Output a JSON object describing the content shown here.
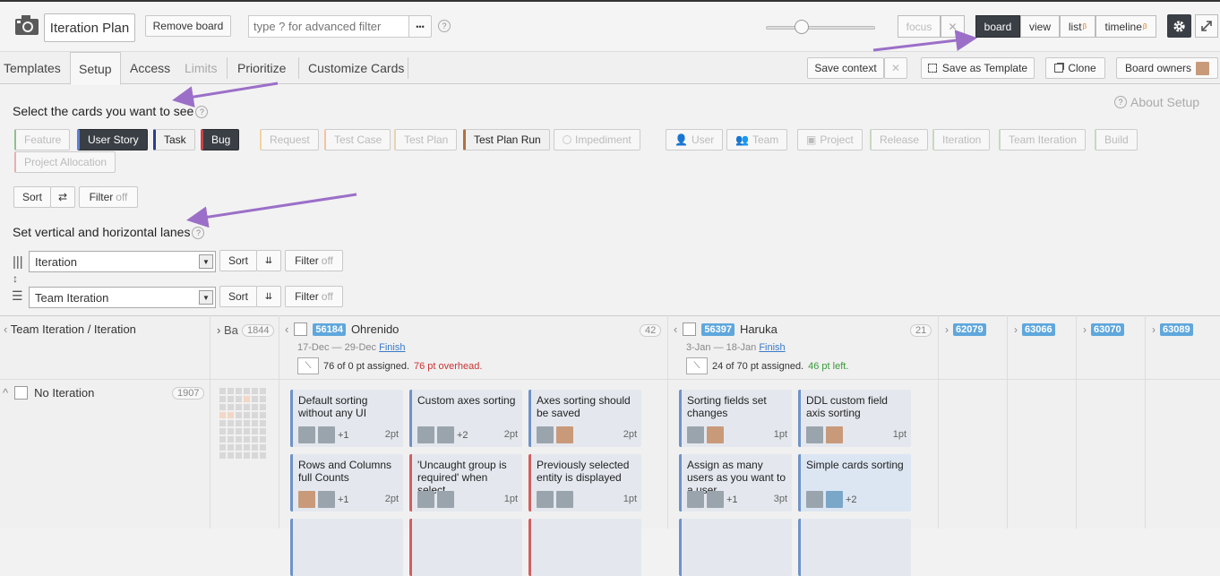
{
  "topbar": {
    "board_title": "Iteration Plan",
    "remove_board": "Remove board",
    "filter_placeholder": "type ? for advanced filter",
    "more": "•••",
    "help": "?",
    "focus": "focus",
    "focus_close": "✕",
    "views": [
      {
        "label": "board",
        "beta": ""
      },
      {
        "label": "view",
        "beta": ""
      },
      {
        "label": "list",
        "beta": "β"
      },
      {
        "label": "timeline",
        "beta": "β"
      }
    ],
    "zoom_level": 0.33
  },
  "tabs": {
    "items": [
      "Templates",
      "Setup",
      "Access",
      "Limits",
      "Prioritize",
      "Customize Cards"
    ],
    "save_context": "Save context",
    "save_template": "Save as Template",
    "clone": "Clone",
    "board_owners": "Board owners"
  },
  "setup": {
    "about": "About Setup",
    "cards_heading": "Select the cards you want to see",
    "card_types": [
      "Feature",
      "User Story",
      "Task",
      "Bug",
      "Request",
      "Test Case",
      "Test Plan",
      "Test Plan Run",
      "Impediment",
      "User",
      "Team",
      "Project",
      "Release",
      "Iteration",
      "Team Iteration",
      "Build",
      "Project Allocation"
    ],
    "sort": "Sort",
    "filter": "Filter",
    "off": "off",
    "lanes_heading": "Set vertical and horizontal lanes",
    "vertical_lane": "Iteration",
    "horizontal_lane": "Team Iteration"
  },
  "board": {
    "corner_label": "Team Iteration / Iteration",
    "backlog_label": "Ba",
    "backlog_count": "1844",
    "columns": [
      {
        "id": "56184",
        "name": "Ohrenido",
        "count": "42",
        "dates": "17-Dec — 29-Dec",
        "finish": "Finish",
        "assigned": "76 of 0 pt assigned.",
        "note": "76 pt overhead."
      },
      {
        "id": "56397",
        "name": "Haruka",
        "count": "21",
        "dates": "3-Jan — 18-Jan",
        "finish": "Finish",
        "assigned": "24 of 70 pt assigned.",
        "note": "46 pt left."
      }
    ],
    "collapsed_ids": [
      "62079",
      "63066",
      "63070",
      "63089"
    ],
    "row_label": "No Iteration",
    "row_count": "1907",
    "cards": [
      {
        "title": "Default sorting without any UI",
        "extra": "+1",
        "pts": "2pt"
      },
      {
        "title": "Custom axes sorting",
        "extra": "+2",
        "pts": "2pt"
      },
      {
        "title": "Axes sorting should be saved",
        "extra": "",
        "pts": "2pt"
      },
      {
        "title": "Rows and Columns full Counts",
        "extra": "+1",
        "pts": "2pt"
      },
      {
        "title": "'Uncaught group is required' when select",
        "extra": "",
        "pts": "1pt"
      },
      {
        "title": "Previously selected entity is displayed",
        "extra": "",
        "pts": "1pt"
      },
      {
        "title": "Sorting fields set changes",
        "extra": "",
        "pts": "1pt"
      },
      {
        "title": "DDL custom field axis sorting",
        "extra": "",
        "pts": "1pt"
      },
      {
        "title": "Assign as many users as you want to a user",
        "extra": "+1",
        "pts": "3pt"
      },
      {
        "title": "Simple cards sorting",
        "extra": "+2",
        "pts": ""
      }
    ],
    "colors": {
      "accent": "#5fa7dc",
      "overhead": "#cc3333",
      "left": "#3a9a3a",
      "arrow": "#9b6fc8"
    }
  }
}
